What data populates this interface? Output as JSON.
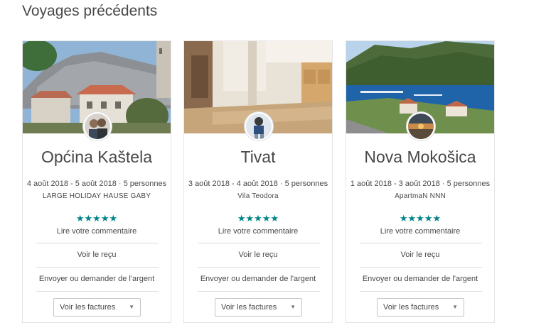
{
  "page": {
    "title": "Voyages précédents"
  },
  "trips": [
    {
      "city": "Općina Kaštela",
      "dates": "4 août 2018 - 5 août 2018 · 5 personnes",
      "listing": "LARGE HOLIDAY HAUSE GABY",
      "stars": "★★★★★",
      "rating": 5,
      "review_label": "Lire votre commentaire",
      "receipt_label": "Voir le reçu",
      "money_label": "Envoyer ou demander de l'argent",
      "invoices_label": "Voir les factures"
    },
    {
      "city": "Tivat",
      "dates": "3 août 2018 - 4 août 2018 · 5 personnes",
      "listing": "Vila Teodora",
      "stars": "★★★★★",
      "rating": 5,
      "review_label": "Lire votre commentaire",
      "receipt_label": "Voir le reçu",
      "money_label": "Envoyer ou demander de l'argent",
      "invoices_label": "Voir les factures"
    },
    {
      "city": "Nova Mokošica",
      "dates": "1 août 2018 - 3 août 2018 · 5 personnes",
      "listing": "ApartmaN NNN",
      "stars": "★★★★★",
      "rating": 5,
      "review_label": "Lire votre commentaire",
      "receipt_label": "Voir le reçu",
      "money_label": "Envoyer ou demander de l'argent",
      "invoices_label": "Voir les factures"
    }
  ],
  "colors": {
    "accent": "#008489",
    "text": "#484848",
    "border": "#e4e4e4"
  },
  "icons": {
    "select_arrow": "caret-down-icon",
    "rating": "star-icon"
  }
}
